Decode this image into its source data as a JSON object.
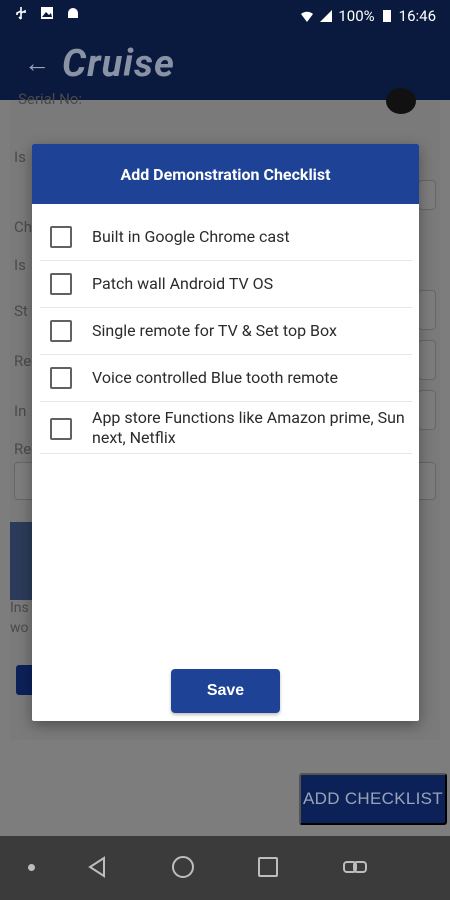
{
  "status_bar": {
    "left_icons": [
      "usb-icon",
      "image-icon",
      "android-icon"
    ],
    "battery": "100%",
    "time": "16:46"
  },
  "app_bar": {
    "brand": "Cruise"
  },
  "background_form": {
    "serial_label": "Serial No:",
    "row_prefixes": [
      "Is",
      "Ch",
      "Is",
      "St",
      "Re",
      "In",
      "Re"
    ],
    "install_text": [
      "Ins",
      "wo"
    ],
    "add_checklist_label": "ADD CHECKLIST"
  },
  "dialog": {
    "title": "Add Demonstration Checklist",
    "items": [
      {
        "label": "Built in Google Chrome cast",
        "checked": false
      },
      {
        "label": "Patch wall Android TV OS",
        "checked": false
      },
      {
        "label": "Single remote for TV & Set top Box",
        "checked": false
      },
      {
        "label": "Voice controlled Blue tooth remote",
        "checked": false
      },
      {
        "label": "App store Functions like Amazon prime, Sun next, Netflix",
        "checked": false
      }
    ],
    "save_label": "Save"
  },
  "colors": {
    "primary": "#1e4396",
    "dim_navy": "#0a1a3e"
  }
}
